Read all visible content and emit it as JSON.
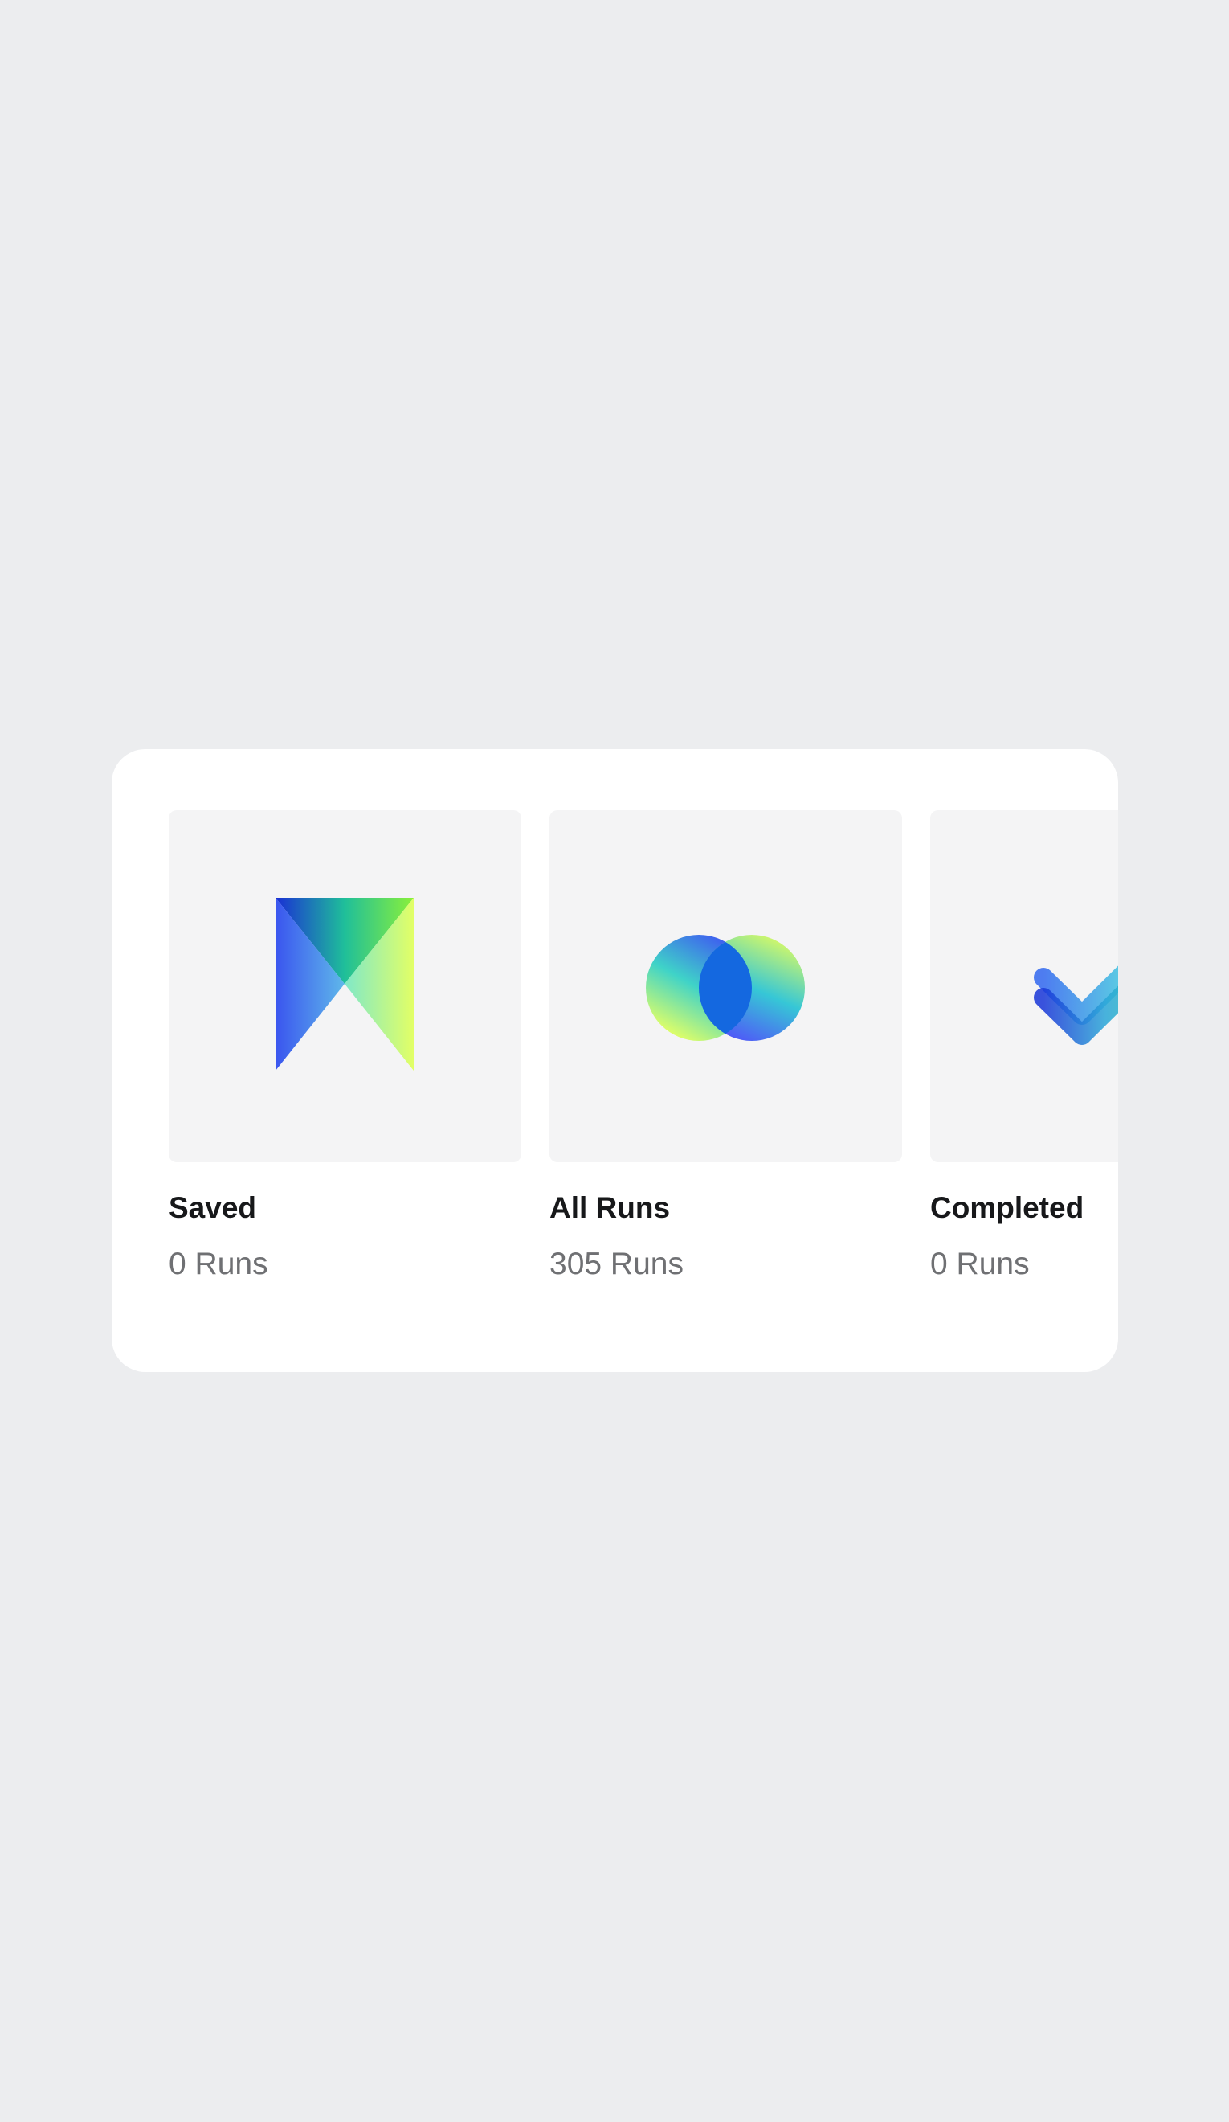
{
  "collections": [
    {
      "title": "Saved",
      "count": "0 Runs",
      "icon": "bookmark-icon"
    },
    {
      "title": "All Runs",
      "count": "305 Runs",
      "icon": "overlapping-circles-icon"
    },
    {
      "title": "Completed",
      "count": "0 Runs",
      "icon": "double-check-icon"
    }
  ],
  "colors": {
    "page_background": "#ecedef",
    "panel_background": "#ffffff",
    "thumbnail_background": "#f4f4f5",
    "title_text": "#17181a",
    "count_text": "#6f7073",
    "gradient_blue": "#1e3fd8",
    "gradient_teal": "#2fd3b6",
    "gradient_lime": "#d9ff6a"
  }
}
